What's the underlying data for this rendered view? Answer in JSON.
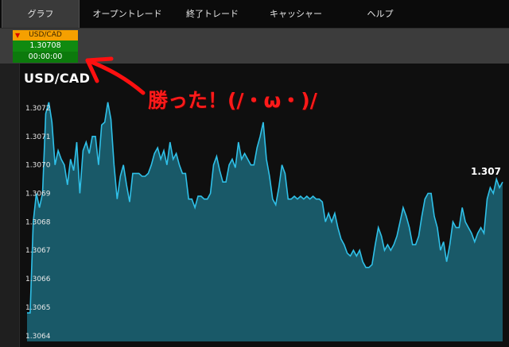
{
  "nav": {
    "tabs": [
      {
        "label": "グラフ",
        "active": true
      },
      {
        "label": "オープントレード",
        "active": false
      },
      {
        "label": "終了トレード",
        "active": false
      },
      {
        "label": "キャッシャー",
        "active": false
      },
      {
        "label": "ヘルプ",
        "active": false
      }
    ]
  },
  "ticker": {
    "symbol": "USD/CAD",
    "direction_icon": "triangle-down-icon",
    "price": "1.30708",
    "time": "00:00:00",
    "colors": {
      "header": "#f5a000",
      "price_bg": "#108a10",
      "arrow": "#d80000"
    }
  },
  "chart_title": "USD/CAD",
  "annotation": "勝った！(/・ω・)/",
  "last_price_label": "1.307",
  "chart_data": {
    "type": "area",
    "title": "USD/CAD",
    "ylim": [
      1.30638,
      1.30725
    ],
    "yticks": [
      "1.3072",
      "1.3071",
      "1.3070",
      "1.3069",
      "1.3068",
      "1.3067",
      "1.3066",
      "1.3065",
      "1.3064"
    ],
    "ytick_values": [
      1.3072,
      1.3071,
      1.307,
      1.3069,
      1.3068,
      1.3067,
      1.3066,
      1.3065,
      1.3064
    ],
    "grid": false,
    "line_color": "#2fc0e8",
    "fill_color": "#1b6678",
    "values": [
      1.30648,
      1.30648,
      1.3068,
      1.3069,
      1.30685,
      1.3069,
      1.30718,
      1.30722,
      1.30715,
      1.307,
      1.30705,
      1.30702,
      1.307,
      1.30693,
      1.30702,
      1.30698,
      1.30708,
      1.3069,
      1.30705,
      1.30708,
      1.30704,
      1.3071,
      1.3071,
      1.307,
      1.30714,
      1.30715,
      1.30722,
      1.30716,
      1.307,
      1.30688,
      1.30696,
      1.307,
      1.30693,
      1.30687,
      1.30697,
      1.30697,
      1.30697,
      1.30696,
      1.30696,
      1.30697,
      1.307,
      1.30704,
      1.30706,
      1.30702,
      1.30705,
      1.307,
      1.30708,
      1.30702,
      1.30704,
      1.307,
      1.30697,
      1.30697,
      1.30688,
      1.30688,
      1.30685,
      1.30689,
      1.30689,
      1.30688,
      1.30688,
      1.3069,
      1.307,
      1.30703,
      1.30698,
      1.30694,
      1.30694,
      1.307,
      1.30702,
      1.30699,
      1.30708,
      1.30702,
      1.30704,
      1.30702,
      1.307,
      1.307,
      1.30706,
      1.3071,
      1.30715,
      1.30702,
      1.30696,
      1.30688,
      1.30686,
      1.30692,
      1.307,
      1.30697,
      1.30688,
      1.30688,
      1.30689,
      1.30688,
      1.30689,
      1.30688,
      1.30689,
      1.30688,
      1.30689,
      1.30688,
      1.30688,
      1.30687,
      1.3068,
      1.30683,
      1.3068,
      1.30683,
      1.30678,
      1.30674,
      1.30672,
      1.30669,
      1.30668,
      1.3067,
      1.30668,
      1.3067,
      1.30666,
      1.30664,
      1.30664,
      1.30665,
      1.30672,
      1.30678,
      1.30675,
      1.3067,
      1.30672,
      1.3067,
      1.30672,
      1.30675,
      1.3068,
      1.30685,
      1.30682,
      1.30678,
      1.30672,
      1.30672,
      1.30675,
      1.30682,
      1.30688,
      1.3069,
      1.3069,
      1.30682,
      1.30678,
      1.3067,
      1.30673,
      1.30666,
      1.30672,
      1.3068,
      1.30678,
      1.30678,
      1.30685,
      1.3068,
      1.30678,
      1.30676,
      1.30673,
      1.30676,
      1.30678,
      1.30676,
      1.30688,
      1.30692,
      1.3069,
      1.30695,
      1.30692,
      1.30694
    ]
  }
}
